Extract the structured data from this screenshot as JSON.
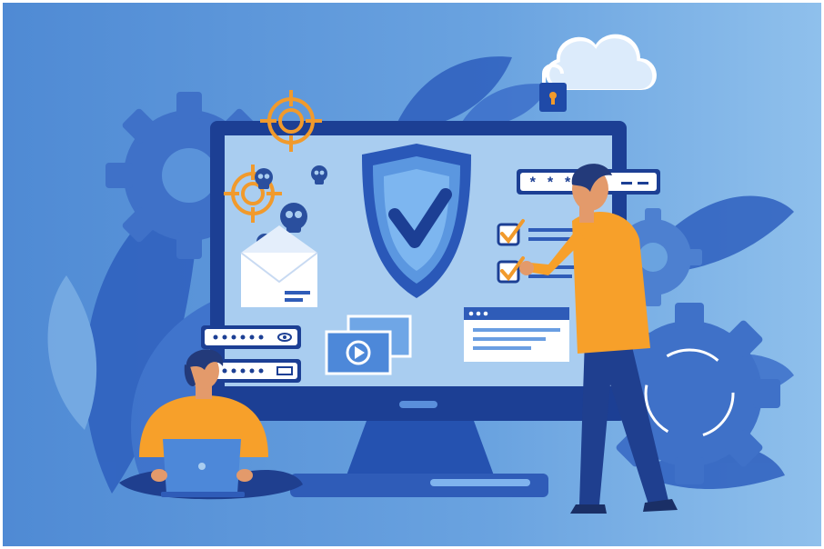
{
  "illustration": {
    "subject": "cybersecurity",
    "password_mask": "* * *",
    "colors": {
      "background": "#5a95d8",
      "background_light": "#8cbdea",
      "deep_blue": "#1c3f94",
      "mid_blue": "#2f5cb8",
      "screen": "#a9cdf0",
      "accent_orange": "#f19a2c",
      "skin": "#e39a6b",
      "hair": "#233a7a",
      "shirt": "#f7a02a",
      "white": "#ffffff"
    },
    "icons": [
      "shield-check-icon",
      "cloud-icon",
      "padlock-icon",
      "crosshair-icon",
      "skull-icon",
      "envelope-icon",
      "video-player-icon",
      "checkbox-icon",
      "password-field-icon",
      "gear-icon",
      "laptop-icon",
      "browser-window-icon"
    ]
  }
}
